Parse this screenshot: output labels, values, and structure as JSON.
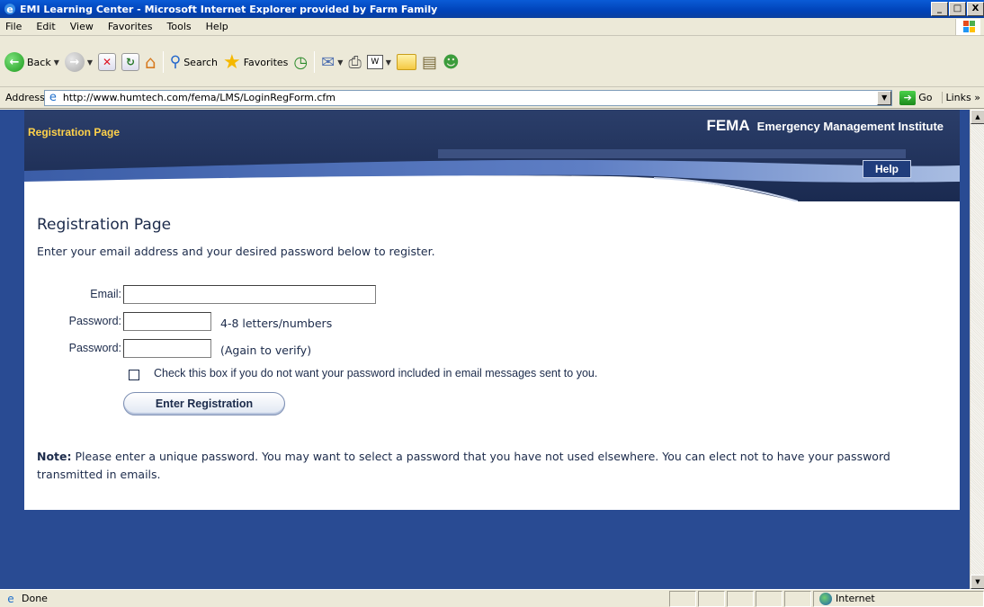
{
  "window": {
    "title": "EMI Learning Center - Microsoft Internet Explorer provided by Farm Family",
    "buttons": {
      "minimize": "_",
      "maximize": "□",
      "close": "X"
    }
  },
  "menubar": {
    "items": [
      {
        "label": "File"
      },
      {
        "label": "Edit"
      },
      {
        "label": "View"
      },
      {
        "label": "Favorites"
      },
      {
        "label": "Tools"
      },
      {
        "label": "Help"
      }
    ]
  },
  "toolbar": {
    "back_label": "Back",
    "search_label": "Search",
    "favorites_label": "Favorites",
    "icons": [
      "back-icon",
      "forward-icon",
      "stop-icon",
      "refresh-icon",
      "home-icon",
      "search-icon",
      "favorites-icon",
      "history-icon",
      "mail-icon",
      "print-icon",
      "edit-icon",
      "folder-icon",
      "research-icon",
      "messenger-icon"
    ]
  },
  "addressbar": {
    "label": "Address",
    "url": "http://www.humtech.com/fema/LMS/LoginRegForm.cfm",
    "go_label": "Go",
    "links_label": "Links",
    "links_chevron": "»"
  },
  "banner": {
    "page_label": "Registration Page",
    "org_short": "FEMA",
    "org_long": "Emergency Management Institute",
    "help_label": "Help"
  },
  "form": {
    "heading": "Registration Page",
    "intro": "Enter your email address and your desired password below to register.",
    "email_label": "Email:",
    "email_value": "",
    "password_label": "Password:",
    "password_hint": "4-8 letters/numbers",
    "password_verify_label": "Password:",
    "password_verify_hint": "(Again to verify)",
    "checkbox_checked": false,
    "checkbox_label": "Check this box if you do not want your password included in email messages sent to you.",
    "submit_label": "Enter Registration",
    "note_label": "Note:",
    "note_text": " Please enter a unique password. You may want to select a password that you have not used elsewhere. You can elect not to have your password transmitted in emails."
  },
  "statusbar": {
    "text": "Done",
    "zone": "Internet"
  },
  "colors": {
    "titlebar": "#0042b8",
    "page_background": "#294b93",
    "banner_accent": "#ffd24a",
    "text": "#1c2b4b"
  }
}
